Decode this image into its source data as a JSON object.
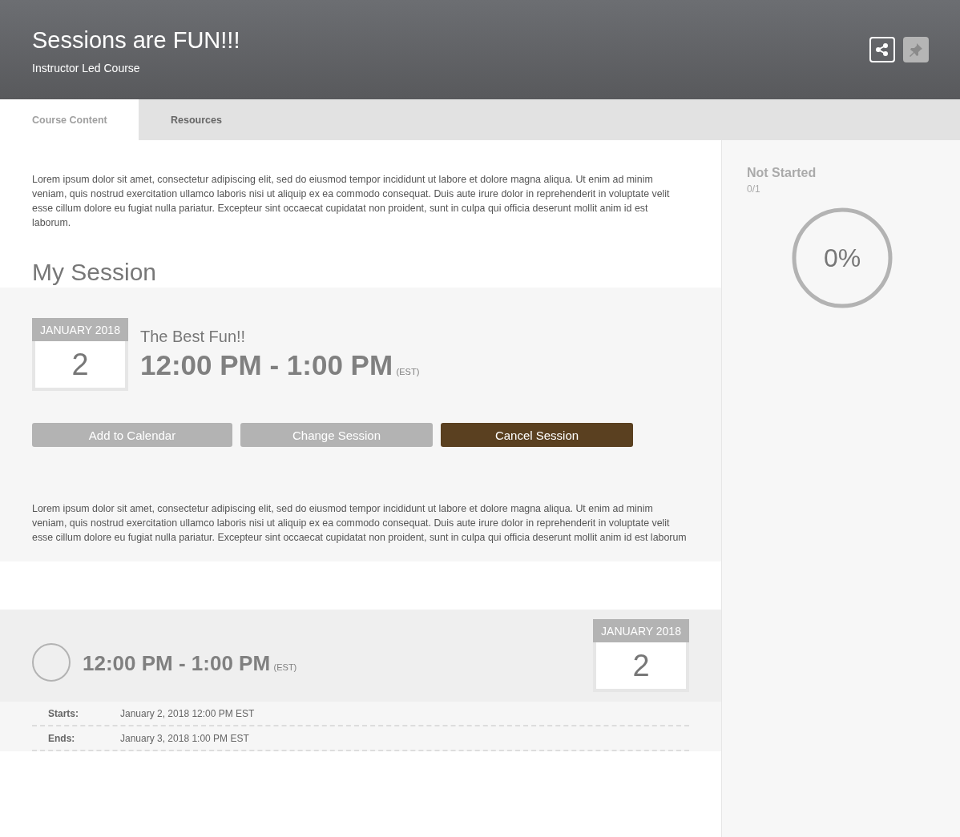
{
  "header": {
    "title": "Sessions are FUN!!!",
    "subtitle": "Instructor Led Course"
  },
  "tabs": [
    {
      "label": "Course Content",
      "selected": true
    },
    {
      "label": "Resources",
      "selected": false
    }
  ],
  "intro": "Lorem ipsum dolor sit amet, consectetur adipiscing elit, sed do eiusmod tempor incididunt ut labore et dolore magna aliqua. Ut enim ad minim veniam, quis nostrud exercitation ullamco laboris nisi ut aliquip ex ea commodo consequat. Duis aute irure dolor in reprehenderit in voluptate velit esse cillum dolore eu fugiat nulla pariatur. Excepteur sint occaecat cupidatat non proident, sunt in culpa qui officia deserunt mollit anim id est laborum.",
  "section_title": "My Session",
  "my_session": {
    "month": "JANUARY 2018",
    "day": "2",
    "name": "The Best Fun!!",
    "time": "12:00 PM - 1:00 PM",
    "zone": "(EST)",
    "buttons": [
      {
        "label": "Add to Calendar",
        "kind": "secondary"
      },
      {
        "label": "Change Session",
        "kind": "secondary"
      },
      {
        "label": "Cancel Session",
        "kind": "primary"
      }
    ],
    "description": "Lorem ipsum dolor sit amet, consectetur adipiscing elit, sed do eiusmod tempor incididunt ut labore et dolore magna aliqua. Ut enim ad minim veniam, quis nostrud exercitation ullamco laboris nisi ut aliquip ex ea commodo consequat. Duis aute irure dolor in reprehenderit in voluptate velit esse cillum dolore eu fugiat nulla pariatur. Excepteur sint occaecat cupidatat non proident, sunt in culpa qui officia deserunt mollit anim id est laborum"
  },
  "sessions": [
    {
      "selected": false,
      "time": "12:00 PM - 1:00 PM",
      "zone": "(EST)",
      "month": "JANUARY 2018",
      "day": "2",
      "details": [
        {
          "label": "Starts:",
          "value": "January 2, 2018 12:00 PM EST"
        },
        {
          "label": "Ends:",
          "value": "January 3, 2018 1:00 PM EST"
        }
      ]
    }
  ],
  "progress": {
    "status": "Not Started",
    "count": "0/1",
    "percent": "0%"
  }
}
